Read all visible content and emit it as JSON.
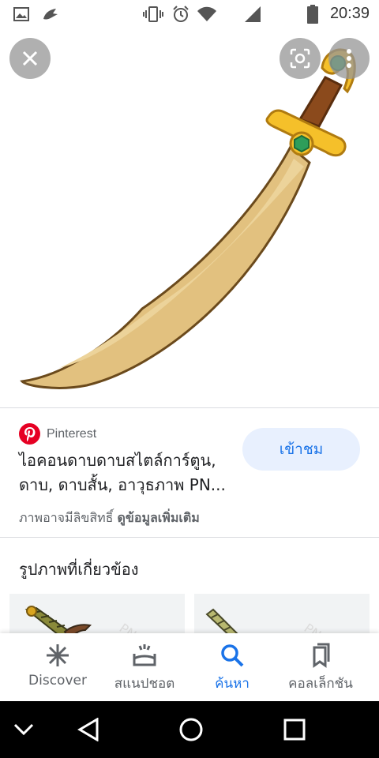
{
  "status_bar": {
    "time": "20:39",
    "icons": [
      "gallery-icon",
      "app-icon",
      "vibrate-icon",
      "alarm-icon",
      "wifi-icon",
      "signal-icon",
      "battery-icon"
    ]
  },
  "viewer": {
    "close_icon": "close-icon",
    "lens_icon": "lens-icon",
    "more_icon": "more-vert-icon"
  },
  "result": {
    "source": "Pinterest",
    "title": "ไอคอนดาบดาบสไตล์การ์ตูน, ดาบ, ดาบสั้น, อาวุธภาพ PN...",
    "visit_label": "เข้าชม",
    "copyright_prefix": "ภาพอาจมีลิขสิทธิ์",
    "copyright_link": "ดูข้อมูลเพิ่มเติม"
  },
  "related": {
    "title": "รูปภาพที่เกี่ยวข้อง"
  },
  "bottom_nav": {
    "items": [
      {
        "label": "Discover",
        "icon": "asterisk-icon"
      },
      {
        "label": "สแนปชอต",
        "icon": "snapshot-icon"
      },
      {
        "label": "ค้นหา",
        "icon": "search-icon"
      },
      {
        "label": "คอลเล็กชัน",
        "icon": "bookmarks-icon"
      }
    ],
    "active": "ค้นหา"
  },
  "colors": {
    "accent": "#1a73e8",
    "visit_bg": "#e8f0fe",
    "pinterest": "#e60023",
    "blade": "#e2c17f",
    "guard": "#f5c02a",
    "handle": "#8b4a1c",
    "gem": "#2e9e5a"
  }
}
